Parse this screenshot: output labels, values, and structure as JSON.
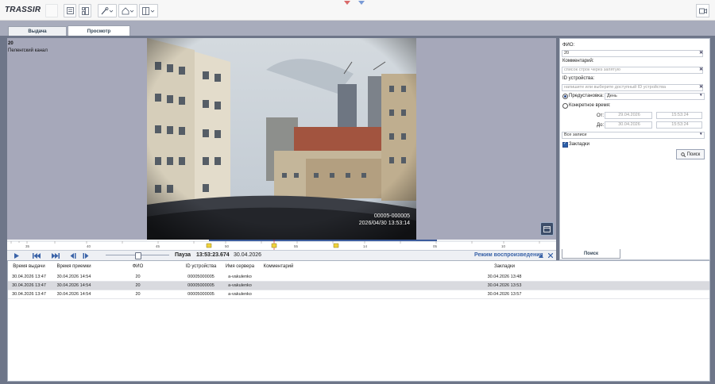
{
  "app": {
    "logo": "TRASSIR",
    "toolbar_icons": [
      "list-icon",
      "layout-icon",
      "wrench-icon",
      "home-icon",
      "split-icon",
      "camera-icon"
    ]
  },
  "tabs": [
    {
      "label": "Выдача",
      "active": false
    },
    {
      "label": "Просмотр",
      "active": true
    }
  ],
  "video": {
    "channel": "20",
    "channel_name": "Пеленгский канал",
    "overlay_id": "00005-000005",
    "overlay_datetime": "2026/04/30 13:53:14"
  },
  "timeline": {
    "ticks": [
      "35",
      "40",
      "45",
      "50",
      "55",
      "14",
      "05",
      "10"
    ]
  },
  "playback": {
    "state": "Пауза",
    "time": "13:53:23.674",
    "date": "30.04.2026",
    "mode": "Режим воспроизведения"
  },
  "search": {
    "fio_label": "ФИО:",
    "fio_value": "20",
    "comment_label": "Комментарий:",
    "comment_placeholder": "список строк через запятую",
    "device_label": "ID устройства:",
    "device_placeholder": "напишите или выберите доступный ID устройства",
    "preset_label": "Предустановка:",
    "preset_value": "День",
    "specific_label": "Конкретное время:",
    "from_label": "От:",
    "from_date": "29.04.2026",
    "from_time": "15:53:24",
    "to_label": "До:",
    "to_date": "30.04.2026",
    "to_time": "15:53:24",
    "records_value": "Все записи",
    "bookmarks_label": "Закладки",
    "search_button": "Поиск",
    "panel_tab": "Поиск"
  },
  "table": {
    "columns": [
      "Время выдачи",
      "Время приемки",
      "ФИО",
      "ID устройства",
      "Имя сервера",
      "Комментарий",
      "Закладки"
    ],
    "rows": [
      [
        "30.04.2026 13:47",
        "30.04.2026 14:54",
        "20",
        "00005000005",
        "a-vakulenko",
        "",
        "30.04.2026 13:48"
      ],
      [
        "30.04.2026 13:47",
        "30.04.2026 14:54",
        "20",
        "00005000005",
        "a-vakulenko",
        "",
        "30.04.2026 13:53"
      ],
      [
        "30.04.2026 13:47",
        "30.04.2026 14:54",
        "20",
        "00005000005",
        "a-vakulenko",
        "",
        "30.04.2026 13:57"
      ]
    ],
    "selected_row": 1
  }
}
